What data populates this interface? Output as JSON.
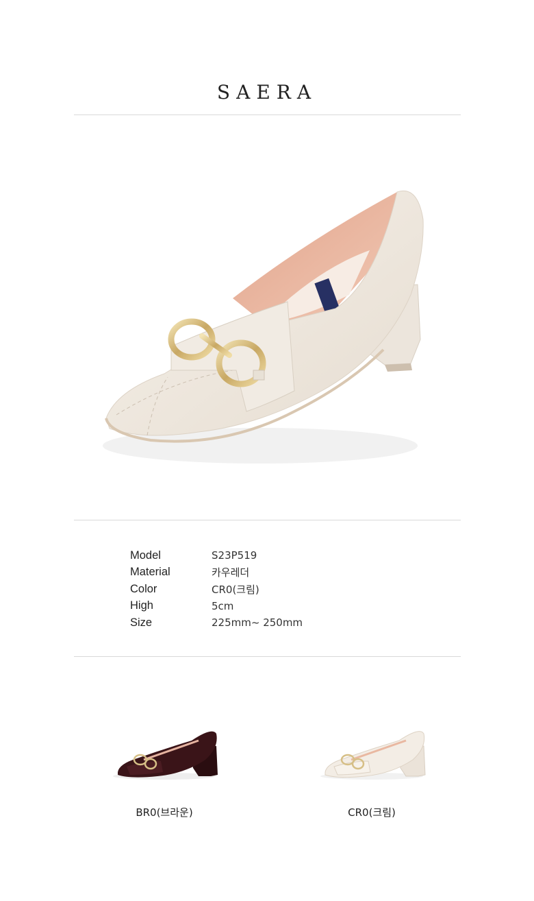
{
  "brand": "SAERA",
  "specs": [
    {
      "label": "Model",
      "value": "S23P519"
    },
    {
      "label": "Material",
      "value": "카우레더"
    },
    {
      "label": "Color",
      "value": "CR0(크림)"
    },
    {
      "label": "High",
      "value": "5cm"
    },
    {
      "label": "Size",
      "value": "225mm~ 250mm"
    }
  ],
  "variants": [
    {
      "label": "BR0(브라운)",
      "color": "#3a1418"
    },
    {
      "label": "CR0(크림)",
      "color": "#efe8df"
    }
  ],
  "colors": {
    "cream": "#efe8df",
    "lining": "#e9b8a1",
    "hardware": "#d6bf86",
    "brown": "#3a1418"
  }
}
